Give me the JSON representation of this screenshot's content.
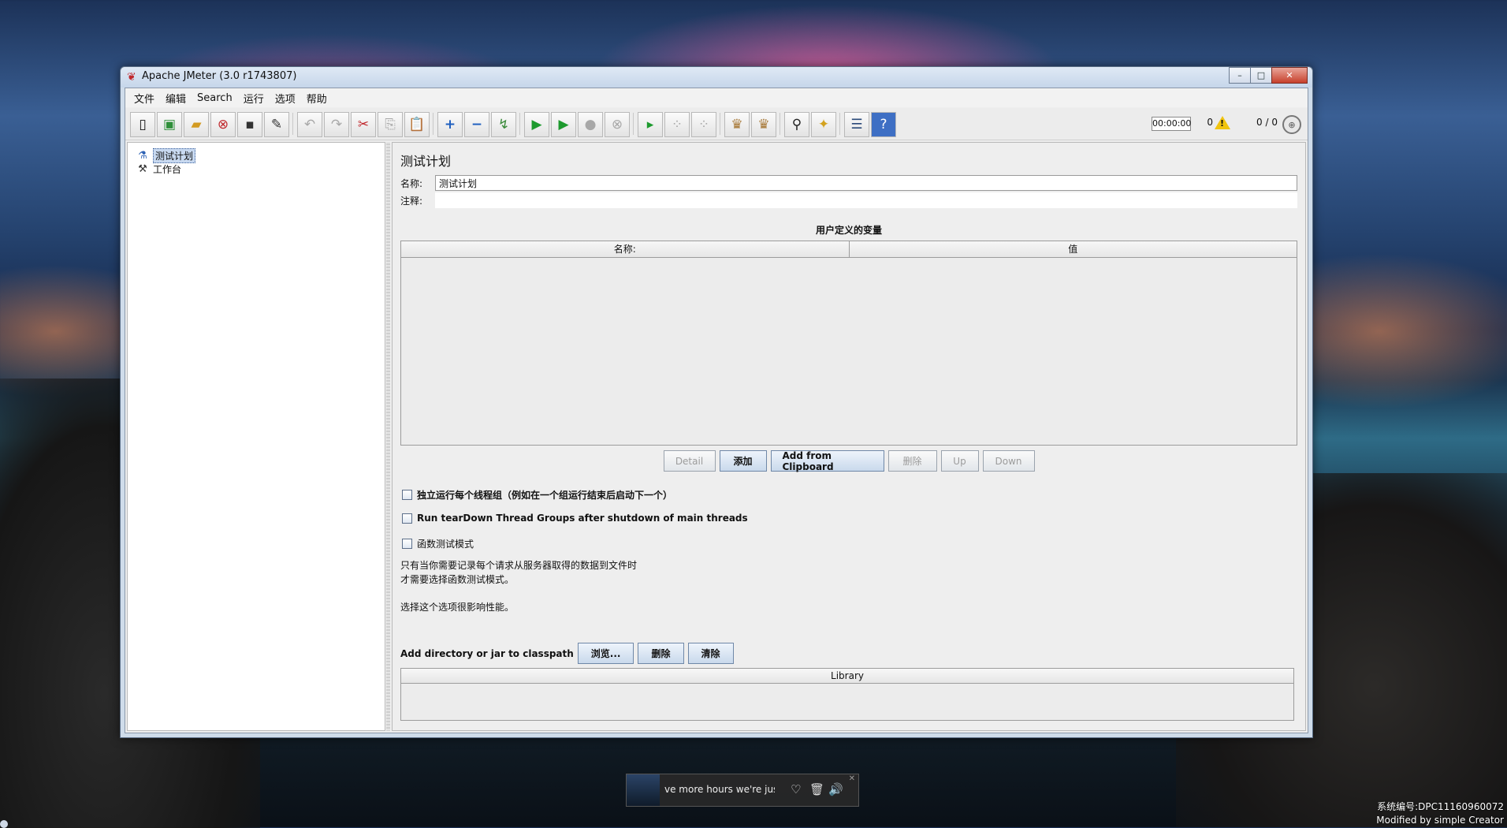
{
  "window": {
    "title": "Apache JMeter (3.0 r1743807)",
    "minimize": "–",
    "maximize": "□",
    "close": "✕"
  },
  "menubar": [
    "文件",
    "编辑",
    "Search",
    "运行",
    "选项",
    "帮助"
  ],
  "toolbar": {
    "timer": "00:00:00",
    "error_count": "0",
    "threads": "0 / 0"
  },
  "tree": {
    "items": [
      {
        "label": "测试计划",
        "icon": "test-plan-icon",
        "selected": true
      },
      {
        "label": "工作台",
        "icon": "workbench-icon",
        "selected": false
      }
    ]
  },
  "panel": {
    "title": "测试计划",
    "name_label": "名称:",
    "name_value": "测试计划",
    "comment_label": "注释:",
    "comment_value": "",
    "variables_title": "用户定义的变量",
    "var_columns": [
      "名称:",
      "值"
    ],
    "var_buttons": {
      "detail": "Detail",
      "add": "添加",
      "add_clipboard": "Add from Clipboard",
      "delete": "删除",
      "up": "Up",
      "down": "Down"
    },
    "checks": [
      {
        "label": "独立运行每个线程组（例如在一个组运行结束后启动下一个）",
        "checked": false
      },
      {
        "label": "Run tearDown Thread Groups after shutdown of main threads",
        "checked": false
      },
      {
        "label": "函数测试模式",
        "checked": false
      }
    ],
    "notes": [
      "只有当你需要记录每个请求从服务器取得的数据到文件时",
      "才需要选择函数测试模式。",
      "选择这个选项很影响性能。"
    ],
    "classpath_label": "Add directory or jar to classpath",
    "classpath_buttons": {
      "browse": "浏览...",
      "delete": "删除",
      "clear": "清除"
    },
    "library_header": "Library"
  },
  "player": {
    "ticker": "ve more hours we're just ge"
  },
  "watermark": {
    "line1": "系统编号:DPC11160960072",
    "line2": "Modified by simple Creator"
  },
  "colors": {
    "window_frame": "#cfdcea",
    "panel_bg": "#eeeeee",
    "selection": "#c8d9f0",
    "warn": "#f1c40f"
  }
}
